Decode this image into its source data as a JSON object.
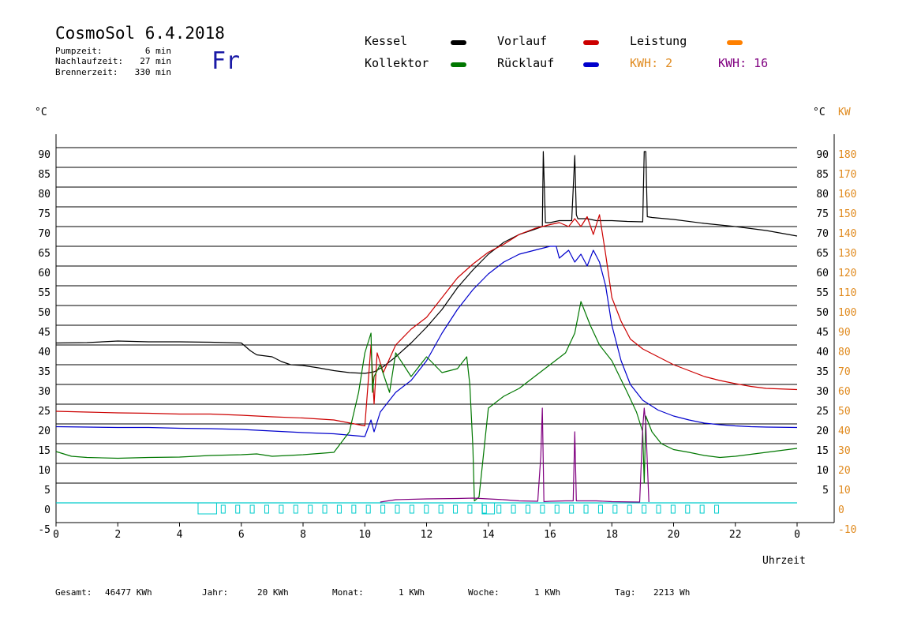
{
  "header": {
    "title": "CosmoSol 6.4.2018",
    "weekday": "Fr",
    "stats": [
      {
        "label": "Pumpzeit:",
        "value": "6 min"
      },
      {
        "label": "Nachlaufzeit:",
        "value": "27 min"
      },
      {
        "label": "Brennerzeit:",
        "value": "330 min"
      }
    ]
  },
  "legend": {
    "kessel": {
      "label": "Kessel",
      "color": "#000000"
    },
    "vorlauf": {
      "label": "Vorlauf",
      "color": "#cc0000"
    },
    "leistung": {
      "label": "Leistung",
      "color": "#ff8000"
    },
    "kollektor": {
      "label": "Kollektor",
      "color": "#007700"
    },
    "ruecklauf": {
      "label": "Rücklauf",
      "color": "#0000cc"
    },
    "kwh1": {
      "label": "KWH: 2",
      "color": "#e08a1e"
    },
    "kwh2": {
      "label": "KWH: 16",
      "color": "#800080"
    }
  },
  "footer": {
    "gesamt_label": "Gesamt:",
    "gesamt_value": "46477 KWh",
    "jahr_label": "Jahr:",
    "jahr_value": "20 KWh",
    "monat_label": "Monat:",
    "monat_value": "1 KWh",
    "woche_label": "Woche:",
    "woche_value": "1 KWh",
    "tag_label": "Tag:",
    "tag_value": "2213 Wh"
  },
  "chart_data": {
    "type": "line",
    "xlabel": "Uhrzeit",
    "ylabel_left": "°C",
    "ylabel_right_inner": "°C",
    "ylabel_right_outer": "KW",
    "xlim": [
      0,
      24
    ],
    "ylim": [
      -5,
      95
    ],
    "x_ticks": [
      "0",
      "2",
      "4",
      "6",
      "8",
      "10",
      "12",
      "14",
      "16",
      "18",
      "20",
      "22",
      "0"
    ],
    "y_ticks_left": [
      "-5",
      "0",
      "5",
      "10",
      "15",
      "20",
      "25",
      "30",
      "35",
      "40",
      "45",
      "50",
      "55",
      "60",
      "65",
      "70",
      "75",
      "80",
      "85",
      "90"
    ],
    "y_ticks_right_inner": [
      "5",
      "10",
      "15",
      "20",
      "25",
      "30",
      "35",
      "40",
      "45",
      "50",
      "55",
      "60",
      "65",
      "70",
      "75",
      "80",
      "85",
      "90"
    ],
    "y_ticks_right_outer": [
      "-10",
      "0",
      "10",
      "20",
      "30",
      "40",
      "50",
      "60",
      "70",
      "80",
      "90",
      "100",
      "110",
      "120",
      "130",
      "140",
      "150",
      "160",
      "170",
      "180"
    ],
    "grid_horizontal": true,
    "series": [
      {
        "name": "Kessel",
        "color": "#000000",
        "x": [
          0,
          1,
          2,
          3,
          4,
          5,
          6,
          6.3,
          6.5,
          7,
          7.3,
          7.6,
          8,
          8.5,
          9,
          9.5,
          10,
          10.3,
          10.6,
          11,
          11.5,
          12,
          12.5,
          13,
          13.5,
          14,
          14.5,
          15,
          15.5,
          15.75,
          15.78,
          15.85,
          16,
          16.3,
          16.7,
          16.8,
          16.85,
          16.9,
          17.2,
          17.5,
          18,
          18.5,
          19,
          19.05,
          19.1,
          19.15,
          19.3,
          20,
          21,
          22,
          23,
          24
        ],
        "y": [
          40.5,
          40.6,
          41,
          40.8,
          40.8,
          40.7,
          40.5,
          38.5,
          37.5,
          37,
          35.8,
          35,
          34.8,
          34.2,
          33.5,
          33,
          32.8,
          33.2,
          34.5,
          37,
          40.5,
          44.5,
          49,
          54.5,
          59,
          63,
          66,
          68,
          69.3,
          70,
          89,
          71,
          71,
          71.5,
          71.5,
          88,
          73,
          72,
          72,
          71.5,
          71.5,
          71.3,
          71.2,
          89,
          89,
          72.5,
          72.3,
          71.8,
          70.8,
          70,
          69,
          67.6
        ]
      },
      {
        "name": "Vorlauf",
        "color": "#cc0000",
        "x": [
          0,
          1,
          2,
          3,
          4,
          5,
          6,
          7,
          8,
          9,
          10,
          10.2,
          10.3,
          10.4,
          10.6,
          11,
          11.5,
          12,
          12.5,
          13,
          13.5,
          14,
          14.5,
          15,
          15.5,
          16,
          16.3,
          16.6,
          16.8,
          17,
          17.2,
          17.4,
          17.6,
          17.8,
          18,
          18.3,
          18.6,
          19,
          19.5,
          20,
          20.5,
          21,
          21.5,
          22,
          22.5,
          23,
          24
        ],
        "y": [
          23.2,
          23,
          22.8,
          22.7,
          22.5,
          22.5,
          22.2,
          21.8,
          21.5,
          21,
          19.5,
          40,
          25,
          38,
          33,
          40,
          44,
          47,
          52,
          57,
          60.5,
          63.5,
          65.5,
          68,
          69.5,
          70.5,
          71,
          70,
          72,
          70,
          72.5,
          68,
          73,
          63,
          52,
          46,
          41.5,
          39,
          37,
          35,
          33.5,
          32,
          31,
          30.2,
          29.5,
          29,
          28.7
        ]
      },
      {
        "name": "Rücklauf",
        "color": "#0000cc",
        "x": [
          0,
          1,
          2,
          3,
          4,
          5,
          6,
          7,
          8,
          9,
          10,
          10.2,
          10.3,
          10.5,
          11,
          11.5,
          12,
          12.5,
          13,
          13.5,
          14,
          14.5,
          15,
          15.5,
          16,
          16.2,
          16.3,
          16.6,
          16.8,
          17,
          17.2,
          17.4,
          17.6,
          17.8,
          18,
          18.3,
          18.6,
          19,
          19.5,
          20,
          20.5,
          21,
          21.5,
          22,
          22.5,
          23,
          24
        ],
        "y": [
          19.3,
          19.2,
          19.1,
          19.1,
          18.9,
          18.8,
          18.6,
          18.2,
          17.8,
          17.5,
          16.8,
          21,
          18,
          23,
          28,
          31,
          36,
          43,
          49,
          54,
          58,
          61,
          63,
          64,
          65,
          65,
          62,
          64,
          61,
          63,
          60,
          64,
          61,
          55,
          45,
          36,
          30,
          26,
          23.5,
          22,
          21,
          20.2,
          19.8,
          19.5,
          19.3,
          19.2,
          19.1
        ]
      },
      {
        "name": "Kollektor",
        "color": "#007700",
        "x": [
          0,
          0.5,
          1,
          2,
          3,
          4,
          5,
          6,
          6.5,
          7,
          8,
          9,
          9.5,
          9.8,
          10,
          10.2,
          10.25,
          10.3,
          10.5,
          10.8,
          11,
          11.5,
          12,
          12.5,
          13,
          13.3,
          13.4,
          13.5,
          13.55,
          13.7,
          14,
          14.5,
          15,
          15.5,
          16,
          16.5,
          16.8,
          17,
          17.3,
          17.6,
          18,
          18.5,
          18.8,
          19,
          19.05,
          19.1,
          19.3,
          19.6,
          20,
          20.5,
          21,
          21.5,
          22,
          23,
          24
        ],
        "y": [
          13,
          11.8,
          11.5,
          11.3,
          11.5,
          11.6,
          12,
          12.2,
          12.4,
          11.8,
          12.2,
          12.8,
          18,
          28,
          38,
          43,
          28,
          32,
          35,
          28,
          38,
          32,
          37,
          33,
          34,
          37,
          30,
          14,
          0.5,
          1.5,
          24,
          27,
          29,
          32,
          35,
          38,
          43,
          51,
          45,
          40,
          36,
          28,
          23,
          18,
          5,
          22,
          18,
          15,
          13.5,
          12.8,
          12,
          11.5,
          11.8,
          12.8,
          13.8
        ]
      },
      {
        "name": "Leistung",
        "color": "#800080",
        "x": [
          10.5,
          11,
          12,
          13,
          13.5,
          14,
          14.5,
          15,
          15.6,
          15.7,
          15.75,
          15.8,
          16,
          16.5,
          16.75,
          16.8,
          16.85,
          16.9,
          17.5,
          18,
          18.9,
          19,
          19.05,
          19.1,
          19.2
        ],
        "y": [
          0.2,
          0.8,
          1,
          1.1,
          1.2,
          1,
          0.8,
          0.5,
          0.4,
          12,
          24,
          0.3,
          0.4,
          0.5,
          0.5,
          18,
          0.5,
          0.5,
          0.5,
          0.3,
          0.2,
          19,
          24,
          20,
          0.2
        ]
      }
    ]
  }
}
